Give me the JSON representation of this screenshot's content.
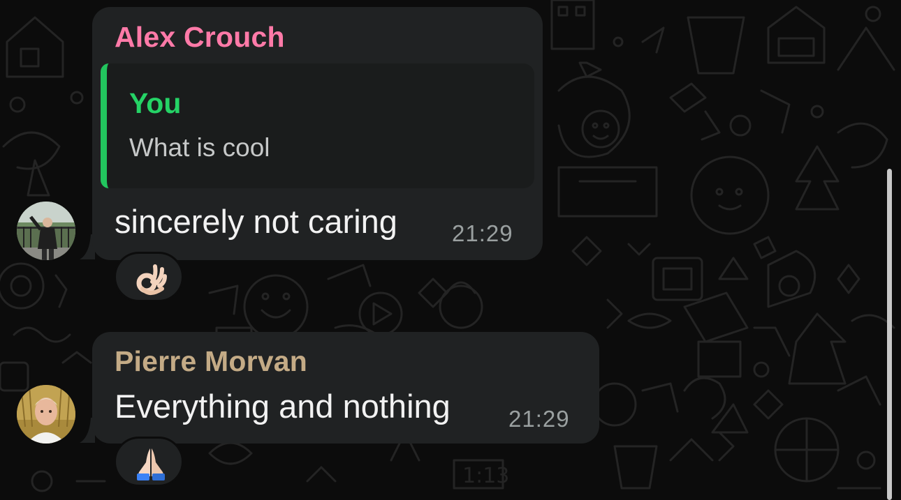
{
  "messages": [
    {
      "sender": "Alex  Crouch",
      "sender_color": "#ff7aa8",
      "avatar_icon": "person-photo-avatar",
      "reply_to": {
        "author": "You",
        "text": "What is cool"
      },
      "text": "sincerely not caring",
      "time": "21:29",
      "reaction": "ok-hand-emoji"
    },
    {
      "sender": "Pierre Morvan",
      "sender_color": "#c4ab86",
      "avatar_icon": "person-photo-avatar",
      "text": "Everything and nothing",
      "time": "21:29",
      "reaction": "folded-hands-emoji"
    }
  ],
  "colors": {
    "bubble": "#202223",
    "quote_accent": "#22c55e",
    "background": "#0c0c0c"
  }
}
